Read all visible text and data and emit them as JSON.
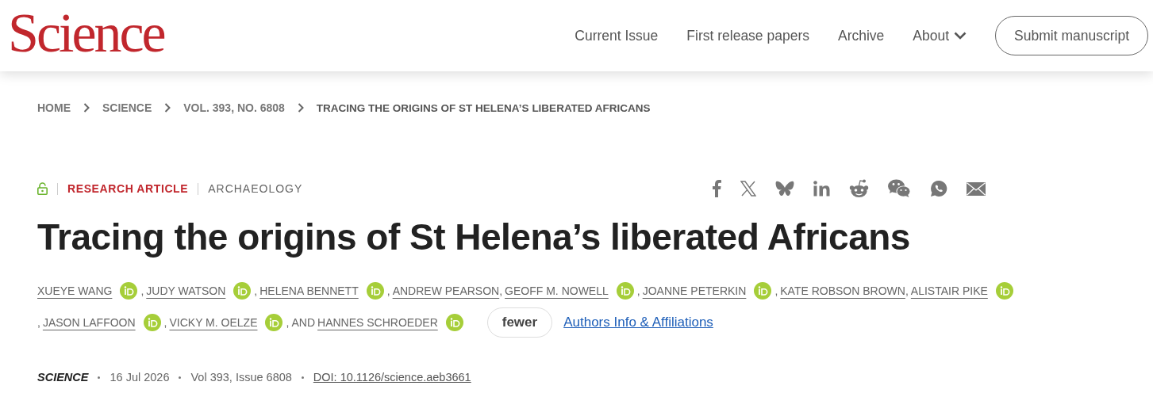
{
  "header": {
    "logo": "Science",
    "nav": [
      {
        "label": "Current Issue",
        "dropdown": false
      },
      {
        "label": "First release papers",
        "dropdown": false
      },
      {
        "label": "Archive",
        "dropdown": false
      },
      {
        "label": "About",
        "dropdown": true
      }
    ],
    "submit_button": "Submit manuscript"
  },
  "breadcrumb": [
    "HOME",
    "SCIENCE",
    "VOL. 393, NO. 6808",
    "TRACING THE ORIGINS OF ST HELENA’S LIBERATED AFRICANS"
  ],
  "article": {
    "open_access": true,
    "type": "RESEARCH ARTICLE",
    "subject": "ARCHAEOLOGY",
    "share": [
      {
        "kind": "facebook"
      },
      {
        "kind": "x"
      },
      {
        "kind": "bluesky"
      },
      {
        "kind": "linkedin"
      },
      {
        "kind": "reddit"
      },
      {
        "kind": "wechat"
      },
      {
        "kind": "whatsapp"
      },
      {
        "kind": "email"
      }
    ],
    "title": "Tracing the origins of St Helena’s liberated Africans",
    "authors": [
      {
        "name": "XUEYE WANG",
        "orcid": true
      },
      {
        "prefix": ",",
        "name": "JUDY WATSON",
        "orcid": true
      },
      {
        "prefix": ",",
        "name": "HELENA BENNETT",
        "orcid": true
      },
      {
        "prefix": ",",
        "name": "ANDREW PEARSON",
        "orcid": false
      },
      {
        "prefix": ",",
        "name": "GEOFF M. NOWELL",
        "orcid": true
      },
      {
        "prefix": ",",
        "name": "JOANNE PETERKIN",
        "orcid": true
      },
      {
        "prefix": ",",
        "name": "KATE ROBSON BROWN",
        "orcid": false
      },
      {
        "prefix": ",",
        "name": "ALISTAIR PIKE",
        "orcid": true
      },
      {
        "prefix": ",",
        "name": "JASON LAFFOON",
        "orcid": true
      },
      {
        "prefix": ",",
        "name": "VICKY M. OELZE",
        "orcid": true
      },
      {
        "prefix": ", AND",
        "name": "HANNES SCHROEDER",
        "orcid": true
      }
    ],
    "fewer_button": "fewer",
    "affiliations_link": "Authors Info & Affiliations",
    "meta": {
      "journal": "SCIENCE",
      "date": "16 Jul 2026",
      "issue": "Vol 393, Issue 6808",
      "doi": "DOI: 10.1126/science.aeb3661"
    }
  }
}
